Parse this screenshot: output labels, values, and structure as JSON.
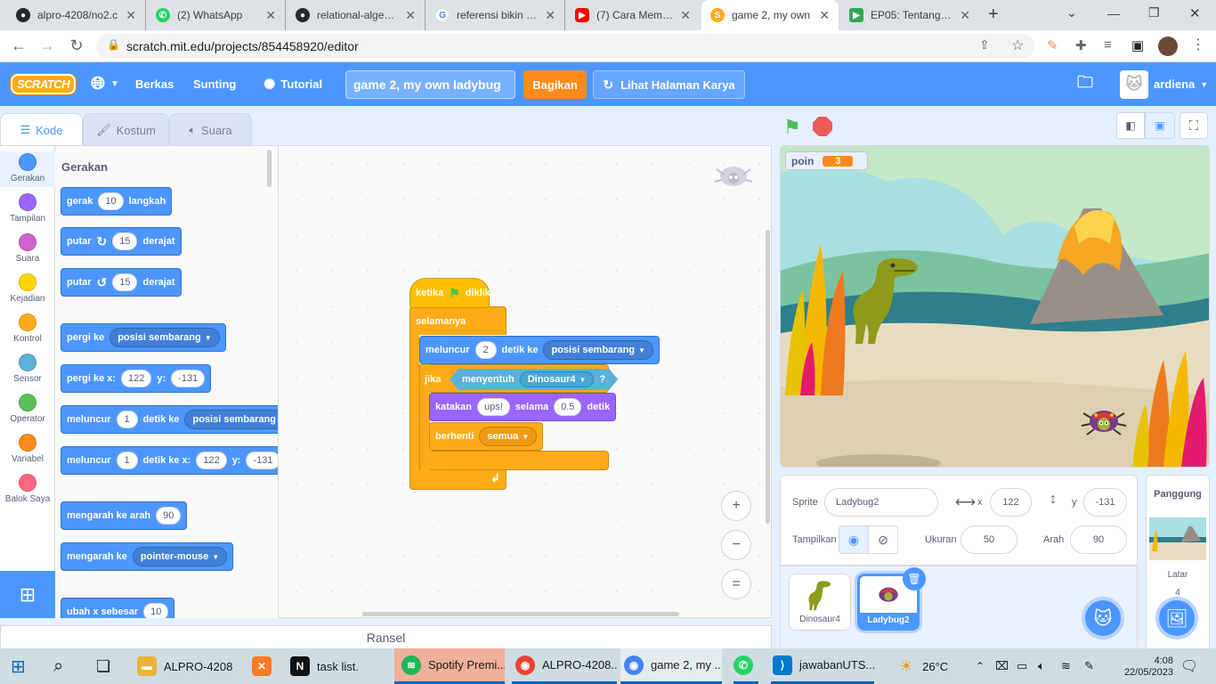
{
  "browser": {
    "tabs": [
      {
        "title": "alpro-4208/no2.c",
        "icon": "github-icon",
        "color": "#24292e"
      },
      {
        "title": "(2) WhatsApp",
        "icon": "whatsapp-icon",
        "color": "#25d366"
      },
      {
        "title": "relational-algebra",
        "icon": "github-icon",
        "color": "#24292e"
      },
      {
        "title": "referensi bikin ga",
        "icon": "google-icon",
        "color": "#4285f4"
      },
      {
        "title": "(7) Cara Membua",
        "icon": "youtube-icon",
        "color": "#ff0000"
      },
      {
        "title": "game 2, my own",
        "icon": "scratch-icon",
        "color": "#ffab19"
      },
      {
        "title": "EP05: Tentang Ci",
        "icon": "play-icon",
        "color": "#34a853"
      }
    ],
    "new_tab": "+",
    "url": "scratch.mit.edu/projects/854458920/editor"
  },
  "menu": {
    "logo": "SCRATCH",
    "file": "Berkas",
    "edit": "Sunting",
    "tutorial": "Tutorial",
    "project_title": "game 2, my own ladybug",
    "share": "Bagikan",
    "see_project_page": "Lihat Halaman Karya",
    "username": "ardiena"
  },
  "editor_tabs": {
    "code": "Kode",
    "costumes": "Kostum",
    "sounds": "Suara"
  },
  "categories": [
    {
      "label": "Gerakan",
      "color": "#4c97ff"
    },
    {
      "label": "Tampilan",
      "color": "#9966ff"
    },
    {
      "label": "Suara",
      "color": "#cf63cf"
    },
    {
      "label": "Kejadian",
      "color": "#ffd500"
    },
    {
      "label": "Kontrol",
      "color": "#ffab19"
    },
    {
      "label": "Sensor",
      "color": "#5cb1d6"
    },
    {
      "label": "Operator",
      "color": "#59c059"
    },
    {
      "label": "Variabel",
      "color": "#ff8c1a"
    },
    {
      "label": "Balok Saya",
      "color": "#ff6680"
    }
  ],
  "palette": {
    "heading": "Gerakan",
    "move": {
      "a": "gerak",
      "n": "10",
      "b": "langkah"
    },
    "turn_right": {
      "a": "putar",
      "n": "15",
      "b": "derajat"
    },
    "turn_left": {
      "a": "putar",
      "n": "15",
      "b": "derajat"
    },
    "goto": {
      "a": "pergi ke",
      "d": "posisi sembarang"
    },
    "goto_xy": {
      "a": "pergi ke x:",
      "x": "122",
      "ylbl": "y:",
      "y": "-131"
    },
    "glide": {
      "a": "meluncur",
      "n": "1",
      "b": "detik ke",
      "d": "posisi sembarang"
    },
    "glide_xy": {
      "a": "meluncur",
      "n": "1",
      "b": "detik ke x:",
      "x": "122",
      "ylbl": "y:",
      "y": "-131"
    },
    "point_dir": {
      "a": "mengarah ke arah",
      "n": "90"
    },
    "point_towards": {
      "a": "mengarah ke",
      "d": "pointer-mouse"
    },
    "change_x": {
      "a": "ubah x sebesar",
      "n": "10"
    }
  },
  "script": {
    "hat": {
      "a": "ketika",
      "b": "diklik"
    },
    "forever": "selamanya",
    "glide": {
      "a": "meluncur",
      "n": "2",
      "b": "detik ke",
      "d": "posisi sembarang"
    },
    "if": "jika",
    "touching": {
      "a": "menyentuh",
      "d": "Dinosaur4",
      "q": "?"
    },
    "say": {
      "a": "katakan",
      "msg": "ups!",
      "b": "selama",
      "n": "0.5",
      "c": "detik"
    },
    "stop": {
      "a": "berhenti",
      "d": "semua"
    }
  },
  "zoom": {
    "in": "+",
    "out": "−",
    "reset": "="
  },
  "backpack": "Ransel",
  "stage": {
    "monitor_label": "poin",
    "monitor_value": "3"
  },
  "sprite_info": {
    "sprite_label": "Sprite",
    "sprite_name": "Ladybug2",
    "x_label": "x",
    "x": "122",
    "y_label": "y",
    "y": "-131",
    "show_label": "Tampilkan",
    "size_label": "Ukuran",
    "size": "50",
    "direction_label": "Arah",
    "direction": "90"
  },
  "sprites": [
    {
      "name": "Dinosaur4",
      "selected": false
    },
    {
      "name": "Ladybug2",
      "selected": true
    }
  ],
  "stage_panel": {
    "title": "Panggung",
    "backdrops_label": "Latar",
    "backdrops_count": "4"
  },
  "taskbar": {
    "items": [
      {
        "label": "ALPRO-4208",
        "icon": "folder-icon",
        "color": "#e8b53a",
        "running": false
      },
      {
        "label": "",
        "icon": "xampp-icon",
        "color": "#fb7a24",
        "running": false
      },
      {
        "label": "task list.",
        "icon": "notion-icon",
        "color": "#111111",
        "running": false
      },
      {
        "label": "Spotify Premi...",
        "icon": "spotify-icon",
        "color": "#1db954",
        "running": true
      },
      {
        "label": "ALPRO-4208...",
        "icon": "chrome-icon",
        "color": "#ea4335",
        "running": true
      },
      {
        "label": "game 2, my ...",
        "icon": "chrome-icon",
        "color": "#4285f4",
        "running": true
      },
      {
        "label": "",
        "icon": "whatsapp-icon",
        "color": "#25d366",
        "running": true
      },
      {
        "label": "jawabanUTS....",
        "icon": "vscode-icon",
        "color": "#007acc",
        "running": true
      }
    ],
    "weather": "26°C",
    "time": "4:08",
    "date": "22/05/2023"
  }
}
